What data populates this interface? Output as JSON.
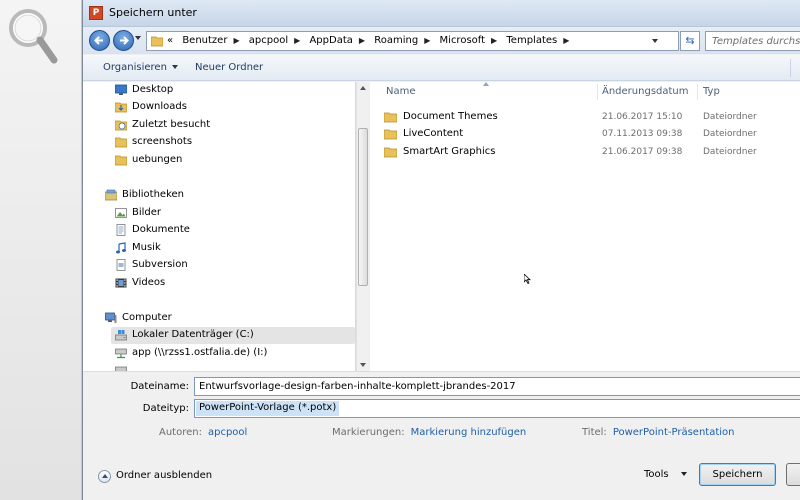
{
  "window": {
    "title": "Speichern unter",
    "app_icon_letter": "P"
  },
  "addressbar": {
    "overflow": "«",
    "breadcrumbs": [
      "Benutzer",
      "apcpool",
      "AppData",
      "Roaming",
      "Microsoft",
      "Templates"
    ],
    "search_placeholder": "Templates durchsuchen"
  },
  "toolbar": {
    "organize": "Organisieren",
    "new_folder": "Neuer Ordner"
  },
  "navigation": {
    "favorites": [
      {
        "label": "Desktop",
        "icon": "desktop-icon"
      },
      {
        "label": "Downloads",
        "icon": "downloads-icon"
      },
      {
        "label": "Zuletzt besucht",
        "icon": "recent-places-icon"
      },
      {
        "label": "screenshots",
        "icon": "folder-icon"
      },
      {
        "label": "uebungen",
        "icon": "folder-icon"
      }
    ],
    "libraries_header": "Bibliotheken",
    "libraries": [
      {
        "label": "Bilder",
        "icon": "pictures-icon"
      },
      {
        "label": "Dokumente",
        "icon": "documents-icon"
      },
      {
        "label": "Musik",
        "icon": "music-icon"
      },
      {
        "label": "Subversion",
        "icon": "subversion-icon"
      },
      {
        "label": "Videos",
        "icon": "videos-icon"
      }
    ],
    "computer_header": "Computer",
    "drives": [
      {
        "label": "Lokaler Datenträger (C:)",
        "icon": "drive-icon",
        "selected": true
      },
      {
        "label": "app (\\\\rzss1.ostfalia.de) (I:)",
        "icon": "network-drive-icon",
        "selected": false
      }
    ]
  },
  "files": {
    "columns": {
      "name": "Name",
      "date": "Änderungsdatum",
      "type": "Typ"
    },
    "rows": [
      {
        "name": "Document Themes",
        "date": "21.06.2017 15:10",
        "type": "Dateiordner"
      },
      {
        "name": "LiveContent",
        "date": "07.11.2013 09:38",
        "type": "Dateiordner"
      },
      {
        "name": "SmartArt Graphics",
        "date": "21.06.2017 09:38",
        "type": "Dateiordner"
      }
    ]
  },
  "form": {
    "filename_label": "Dateiname:",
    "filename_value": "Entwurfsvorlage-design-farben-inhalte-komplett-jbrandes-2017",
    "filetype_label": "Dateityp:",
    "filetype_value": "PowerPoint-Vorlage (*.potx)",
    "authors_label": "Autoren:",
    "authors_value": "apcpool",
    "tags_label": "Markierungen:",
    "tags_value": "Markierung hinzufügen",
    "title_label": "Titel:",
    "title_value": "PowerPoint-Präsentation"
  },
  "footer": {
    "hide_folders": "Ordner ausblenden",
    "tools": "Tools",
    "save": "Speichern"
  },
  "colors": {
    "link": "#1f5fa8",
    "selection": "#cce3f7",
    "titlebar": "#c6d5e8",
    "folder": "#e8c15a"
  }
}
